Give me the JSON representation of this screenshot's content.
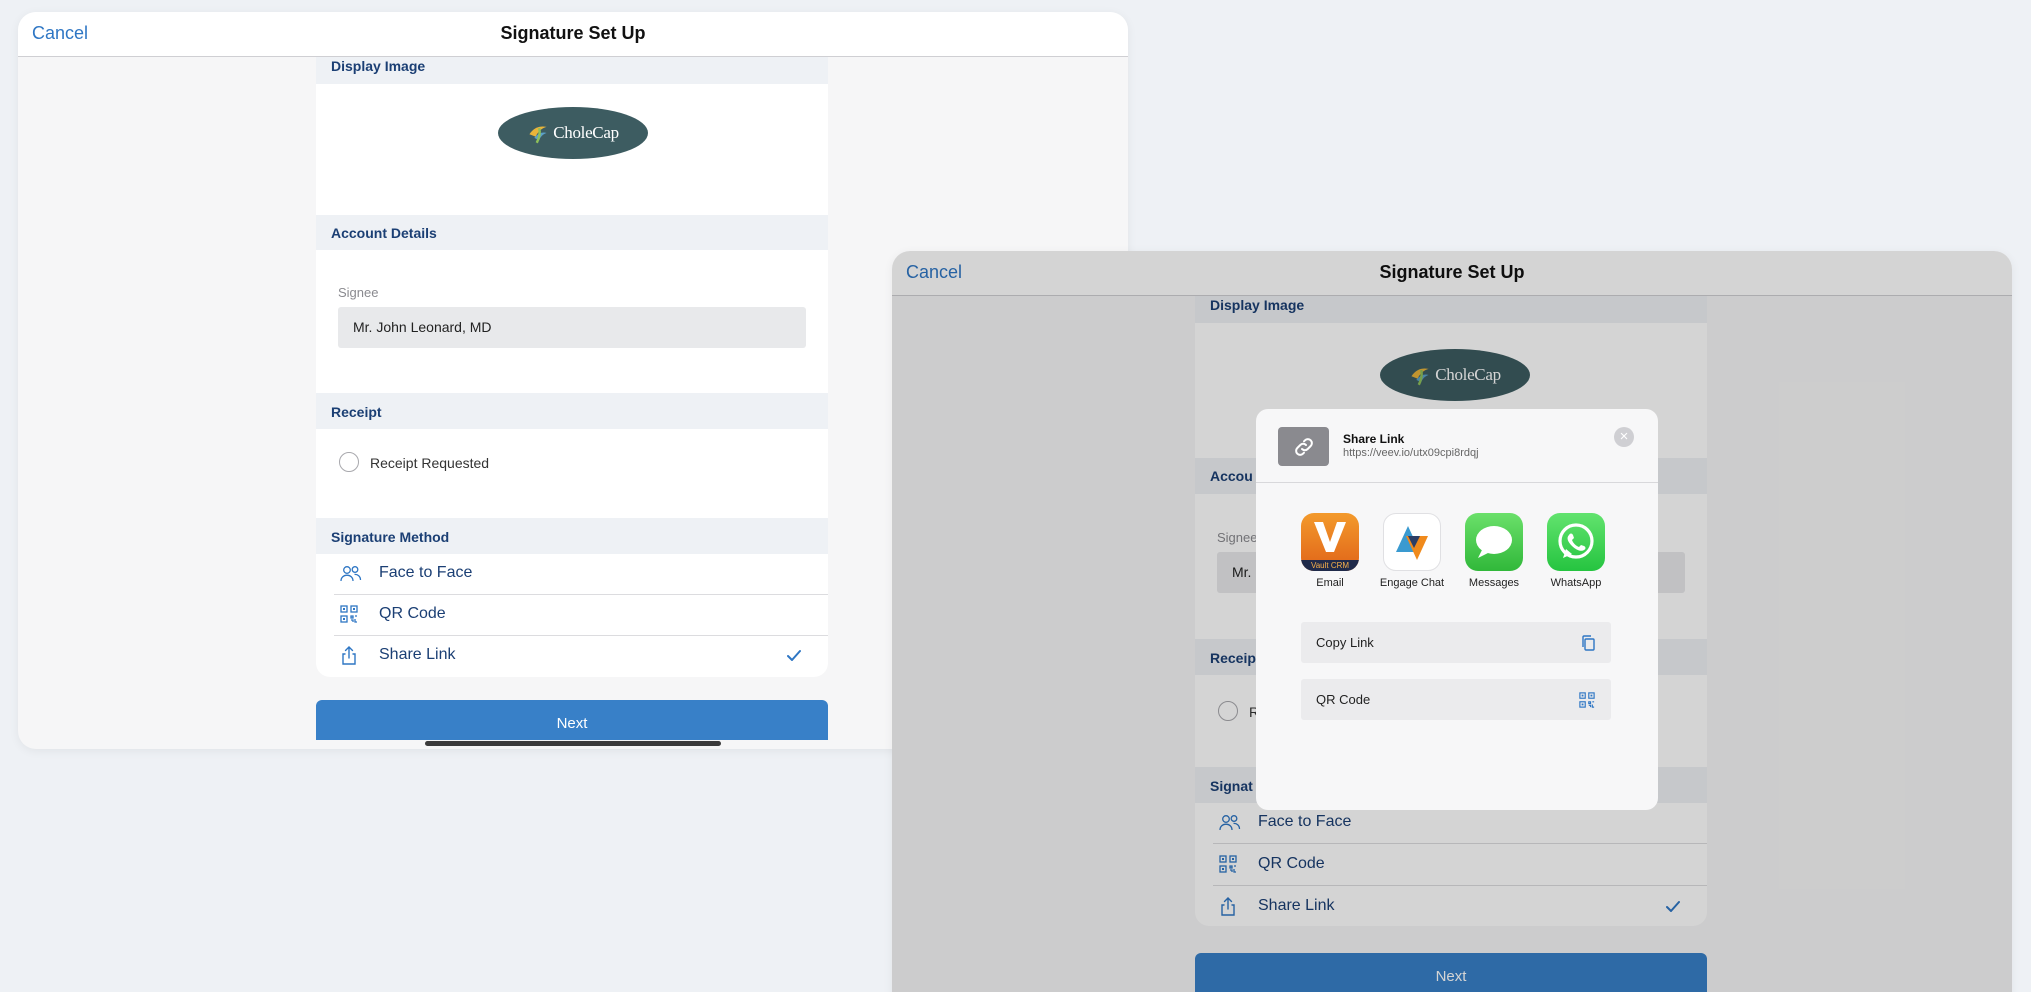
{
  "window1": {
    "nav": {
      "cancel": "Cancel",
      "title": "Signature Set Up"
    },
    "sections": {
      "display_image": "Display Image",
      "account_details": "Account Details",
      "receipt": "Receipt",
      "signature_method": "Signature Method"
    },
    "logo_text": "CholeCap",
    "signee": {
      "label": "Signee",
      "value": "Mr. John Leonard, MD"
    },
    "receipt_option": "Receipt Requested",
    "methods": [
      {
        "label": "Face to Face",
        "icon": "people-icon"
      },
      {
        "label": "QR Code",
        "icon": "qr-code-icon"
      },
      {
        "label": "Share Link",
        "icon": "share-icon",
        "selected": true
      }
    ],
    "next": "Next"
  },
  "window2": {
    "nav": {
      "cancel": "Cancel",
      "title": "Signature Set Up"
    },
    "sections": {
      "display_image": "Display Image",
      "account_details": "Accou",
      "receipt": "Receip",
      "signature_method": "Signat"
    },
    "logo_text": "CholeCap",
    "signee": {
      "label": "Signee",
      "value": "Mr."
    },
    "receipt_option": "R",
    "methods": [
      {
        "label": "Face to Face"
      },
      {
        "label": "QR Code"
      },
      {
        "label": "Share Link",
        "selected": true
      }
    ],
    "next": "Next"
  },
  "share_sheet": {
    "title": "Share Link",
    "url": "https://veev.io/utx09cpi8rdqj",
    "close_glyph": "×",
    "vault_badge": "Vault CRM",
    "apps": [
      {
        "name": "Email",
        "icon": "vault-crm-icon"
      },
      {
        "name": "Engage Chat",
        "icon": "engage-chat-icon"
      },
      {
        "name": "Messages",
        "icon": "messages-icon"
      },
      {
        "name": "WhatsApp",
        "icon": "whatsapp-icon"
      }
    ],
    "actions": [
      {
        "label": "Copy Link",
        "icon": "copy-icon"
      },
      {
        "label": "QR Code",
        "icon": "qr-code-icon"
      }
    ]
  },
  "colors": {
    "accent": "#2e76c4",
    "section_text": "#1b3f74",
    "next_button": "#3880c8",
    "logo_bg": "#3d5c61"
  }
}
